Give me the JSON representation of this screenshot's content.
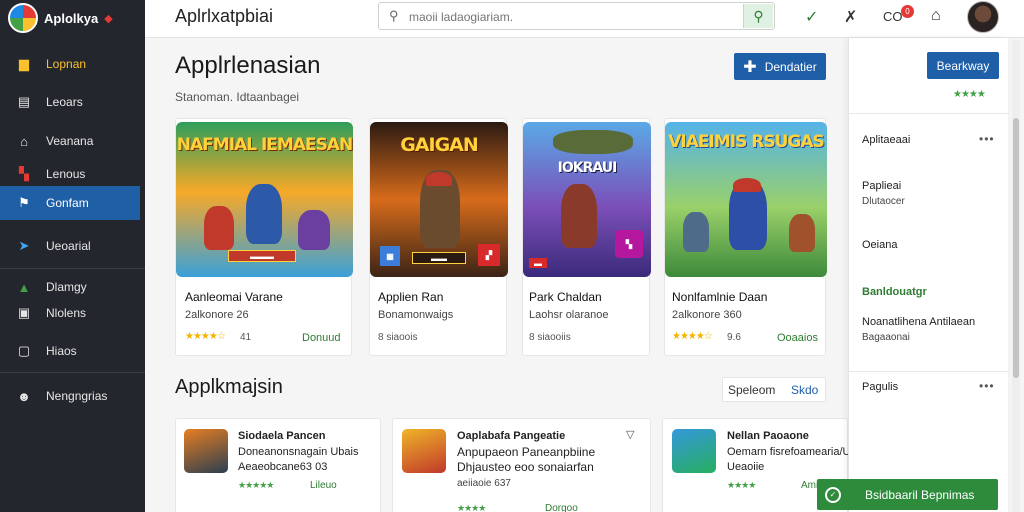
{
  "app": {
    "logo_text": "Aplolkya",
    "logo_dot": "◆"
  },
  "sidebar": {
    "items": [
      {
        "label": "Lopnan",
        "icon": "folder-icon"
      },
      {
        "label": "Leoars",
        "icon": "list-icon"
      },
      {
        "label": "Veanana",
        "icon": "home-icon"
      },
      {
        "label": "Lenous",
        "icon": "grid-icon"
      },
      {
        "label": "Gonfam",
        "icon": "flag-icon"
      },
      {
        "label": "Ueoarial",
        "icon": "send-icon"
      },
      {
        "label": "Dlamgy",
        "icon": "chart-icon"
      },
      {
        "label": "Nlolens",
        "icon": "box-icon"
      },
      {
        "label": "Hiaos",
        "icon": "window-icon"
      },
      {
        "label": "Nengngrias",
        "icon": "user-icon"
      }
    ]
  },
  "topbar": {
    "title": "Aplrlxatpbiai",
    "search_placeholder": "maoii ladaogiariam.",
    "cart_label": "CO",
    "cart_badge": "0"
  },
  "main": {
    "title": "Applrlenasian",
    "subtitle": "Stanoman. Idtaanbagei",
    "primary_button": "Dendatier",
    "cards": [
      {
        "name": "Aanleomai Varane",
        "sub": "2alkonore 26",
        "meta": "41",
        "action": "Donuud",
        "art_title": "NAFMIAL IEMAESAN"
      },
      {
        "name": "Applien Ran",
        "sub": "Bonamonwaigs",
        "meta": "8 siaoois",
        "action": "",
        "art_title": "GAIGAN"
      },
      {
        "name": "Park Chaldan",
        "sub": "Laohsr olaranoe",
        "meta": "8 siaooiis",
        "action": "",
        "art_title": "IOKRAUI"
      },
      {
        "name": "Nonlfamlnie Daan",
        "sub": "2alkonore 360",
        "meta": "9.6",
        "action": "Ooaaios",
        "art_title": "VIAEIMIS RSUGAS"
      }
    ],
    "section_title": "Applkmajsin",
    "sort_label": "Speleom",
    "sort_link": "Skdo",
    "list": [
      {
        "line1": "Siodaela Pancen",
        "line2": "Doneanonsnagain Ubais",
        "line3": "Aeaeobcane63 03",
        "price": "Lileuo"
      },
      {
        "line1": "Oaplabafa Pangeatie",
        "line2": "Anpupaeon Paneanpbiine",
        "line3": "Dhjausteo eoo sonaiarfan",
        "line4": "aeiiaoie 637",
        "price": "Dorgoo"
      },
      {
        "line1": "Nellan Paoaone",
        "line2": "Oemarn fisrefoamearia/Ue",
        "line3": "Ueaoiie",
        "price": "Amiloo"
      }
    ]
  },
  "panel": {
    "button": "Bearkway",
    "rows": [
      {
        "line1": "Aplitaeaai"
      },
      {
        "line1": "Paplieai",
        "line2": "Dlutaocer"
      },
      {
        "line1": "Oeiana"
      },
      {
        "line1": "Banldouatgr"
      },
      {
        "line1": "Noanatlihena Antilaean",
        "line2": "Bagaaonai"
      },
      {
        "line1": "Pagulis"
      }
    ]
  },
  "toast": {
    "label": "Bsidbaaril Bepnimas"
  },
  "colors": {
    "accent": "#1e5fa8",
    "sidebar_bg": "#23272d",
    "success": "#2e8b3c",
    "star": "#f4b400"
  }
}
